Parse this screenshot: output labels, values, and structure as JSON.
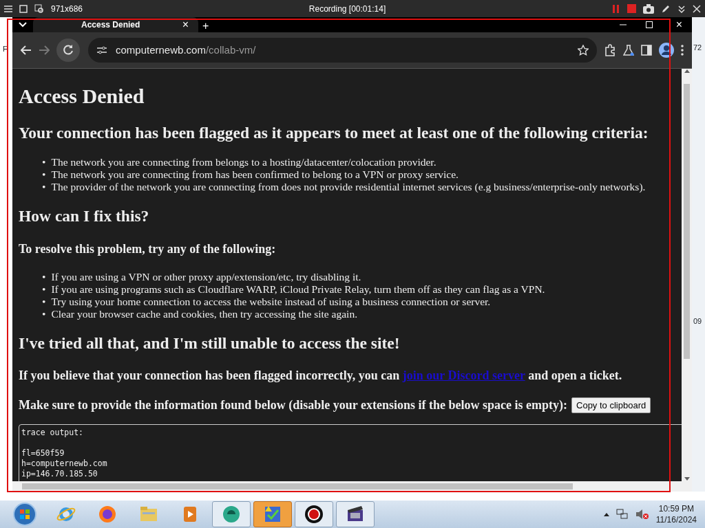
{
  "recorder": {
    "size": "971x686",
    "title": "Recording [00:01:14]"
  },
  "desktop_fragments": [
    "F",
    "72",
    "09"
  ],
  "browser": {
    "tabs": [
      {
        "title": "Access Denied",
        "close": "×",
        "selected": true
      }
    ],
    "new_tab": "+",
    "close": "×",
    "url": {
      "host": "computernewb.com",
      "path": "/collab-vm/"
    }
  },
  "page": {
    "title": "Access Denied",
    "criteria_heading": "Your connection has been flagged as it appears to meet at least one of the following criteria:",
    "criteria": [
      "The network you are connecting from belongs to a hosting/datacenter/colocation provider.",
      "The network you are connecting from has been confirmed to belong to a VPN or proxy service.",
      "The provider of the network you are connecting from does not provide residential internet services (e.g business/enterprise-only networks)."
    ],
    "bullet": "•",
    "fix_heading": "How can I fix this?",
    "resolve_heading": "To resolve this problem, try any of the following:",
    "fixes": [
      "If you are using a VPN or other proxy app/extension/etc, try disabling it.",
      "If you are using programs such as Cloudflare WARP, iCloud Private Relay, turn them off as they can flag as a VPN.",
      "Try using your home connection to access the website instead of using a business connection or server.",
      "Clear your browser cache and cookies, then try accessing the site again."
    ],
    "tried_heading": "I've tried all that, and I'm still unable to access the site!",
    "support": {
      "before": "If you believe that your connection has been flagged incorrectly, you can ",
      "link": "join our Discord server",
      "after": " and open a ticket."
    },
    "info": "Make sure to provide the information found below (disable your extensions if the below space is empty):",
    "copy_button": "Copy to clipboard",
    "trace_heading": "trace output:",
    "trace_lines": [
      "fl=650f59",
      "h=computernewb.com",
      "ip=146.70.185.50"
    ]
  },
  "taskbar": {
    "apps": [
      {
        "kind": "ie",
        "running": false,
        "selected": false
      },
      {
        "kind": "firefox",
        "running": false,
        "selected": false
      },
      {
        "kind": "folder",
        "running": false,
        "selected": false
      },
      {
        "kind": "media",
        "running": false,
        "selected": false
      },
      {
        "kind": "teal",
        "running": true,
        "selected": false
      },
      {
        "kind": "tasks",
        "running": true,
        "selected": true
      },
      {
        "kind": "record",
        "running": true,
        "selected": false
      },
      {
        "kind": "film",
        "running": true,
        "selected": false
      }
    ],
    "clock": {
      "time": "10:59 PM",
      "date": "11/16/2024"
    }
  }
}
